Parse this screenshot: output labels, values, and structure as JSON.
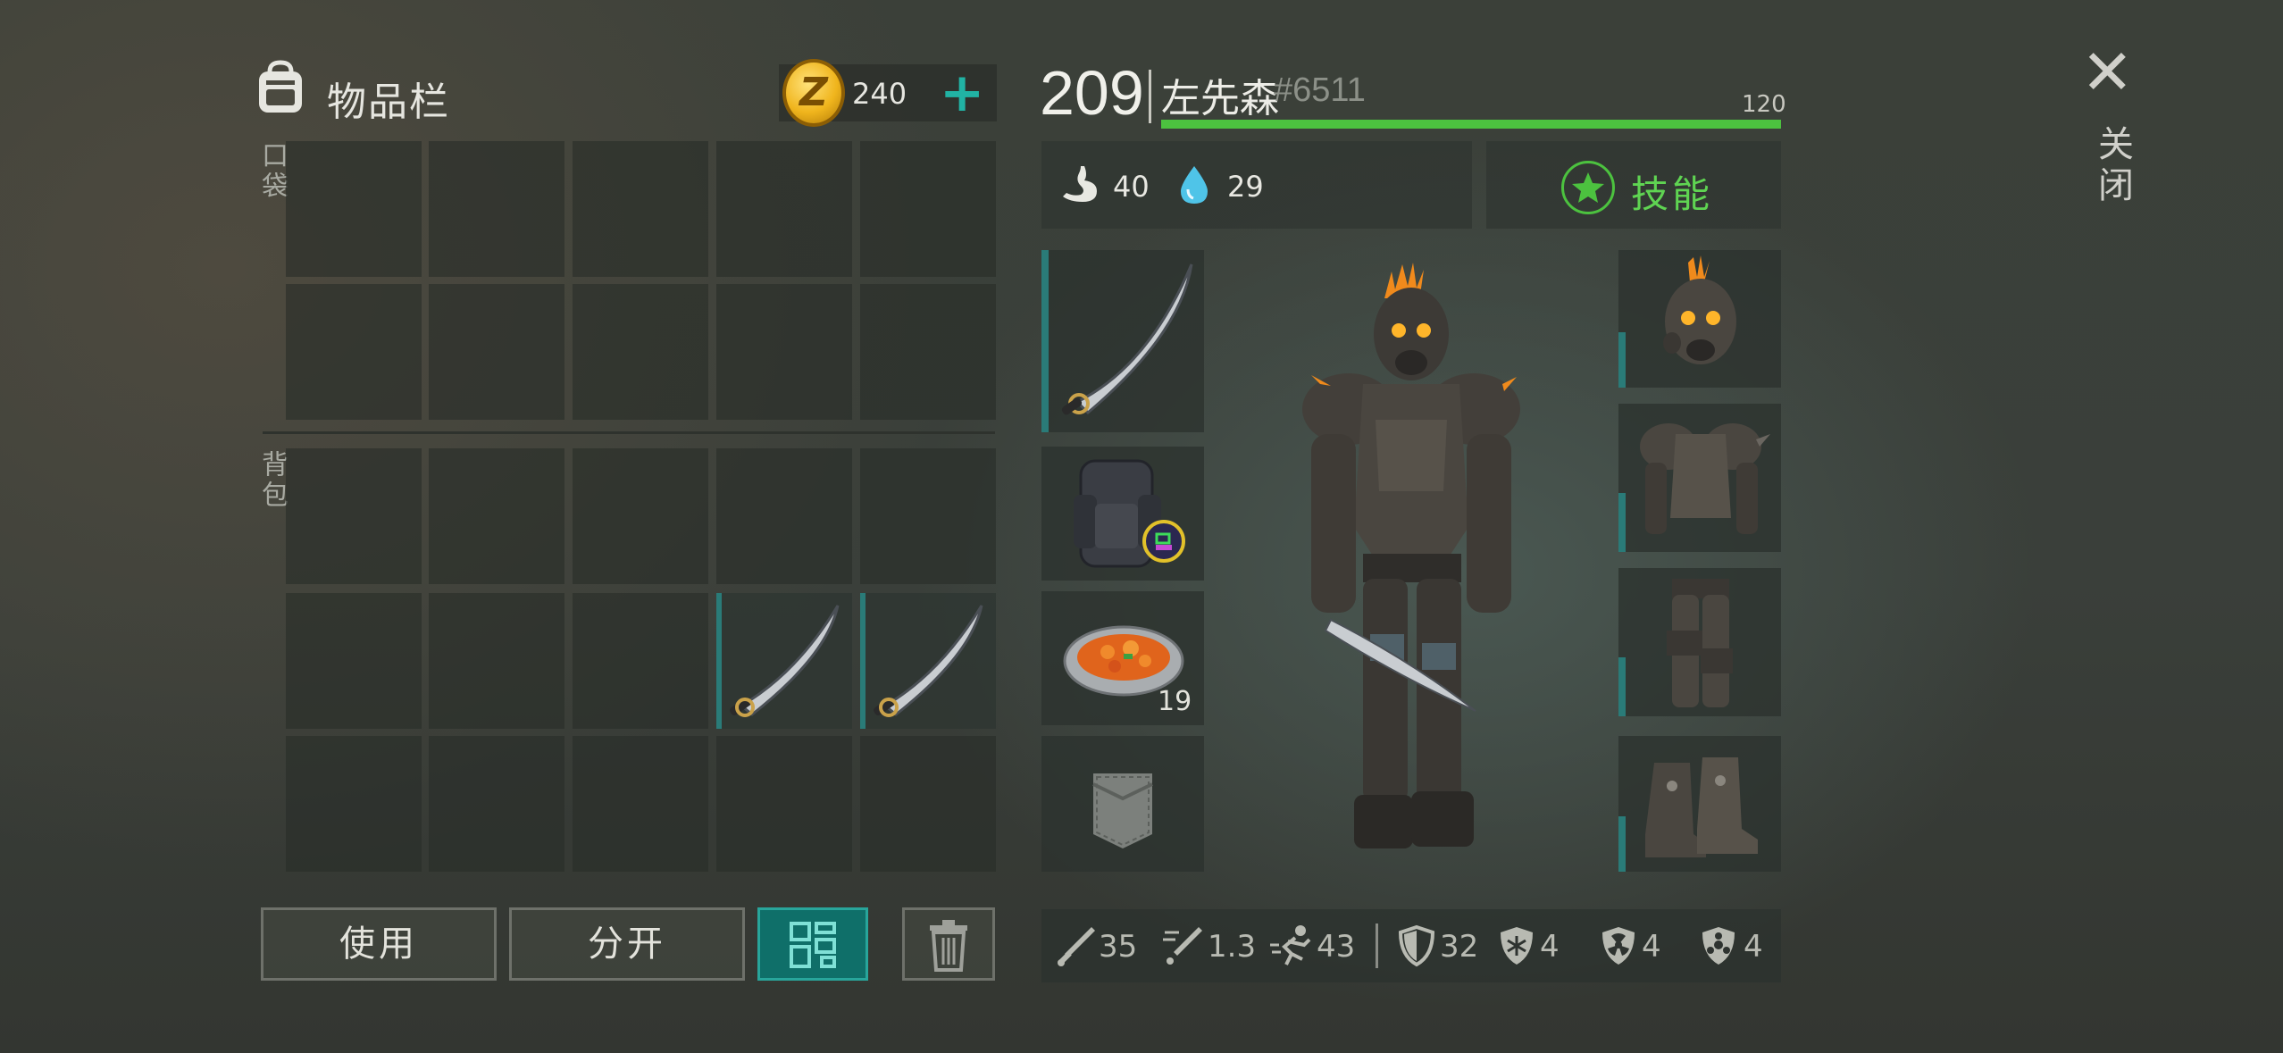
{
  "inventory": {
    "title": "物品栏",
    "coins": "240",
    "coin_symbol": "Z",
    "pocket_label": "口袋",
    "backpack_label": "背包",
    "stack_count": "19"
  },
  "actions": {
    "use": "使用",
    "split": "分开"
  },
  "character": {
    "level": "209",
    "name": "左先森",
    "tag": "#6511",
    "xp_max": "120",
    "xp_fraction": 1.0,
    "hunger": "40",
    "thirst": "29",
    "skills_label": "技能"
  },
  "close_label": "关闭",
  "stats": {
    "damage": "35",
    "attack_speed": "1.3",
    "speed": "43",
    "armor": "32",
    "cold": "4",
    "radiation": "4",
    "toxic": "4"
  },
  "icons": {
    "backpack": "backpack-icon",
    "plus": "plus-icon",
    "grid": "grid-icon",
    "trash": "trash-icon",
    "close": "close-icon",
    "hunger": "stomach-icon",
    "thirst": "water-drop-icon",
    "skills": "star-icon"
  },
  "colors": {
    "accent_teal": "#21b3a4",
    "xp_green": "#4cc23f",
    "coin_gold": "#f0b51d"
  }
}
